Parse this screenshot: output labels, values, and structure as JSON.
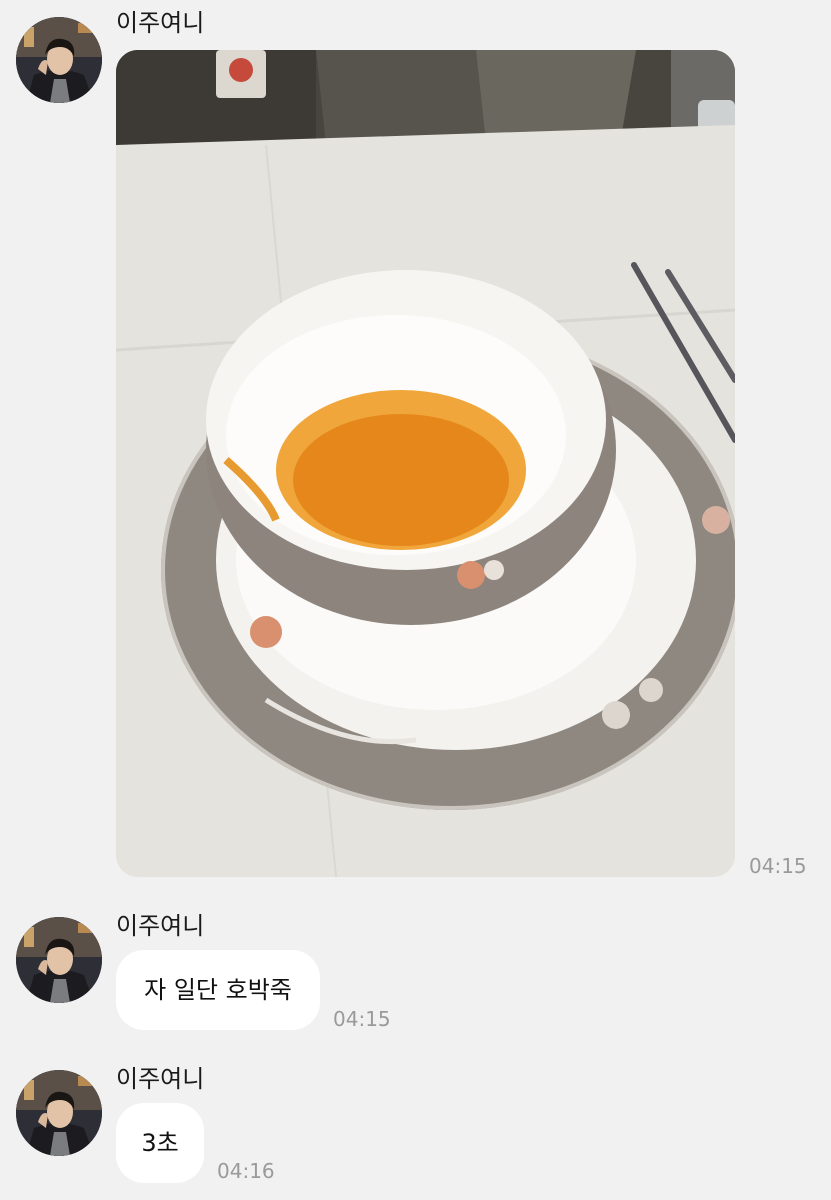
{
  "messages": [
    {
      "sender": "이주여니",
      "type": "photo",
      "photo_subject": "bowl-of-pumpkin-porridge",
      "time": "04:15"
    },
    {
      "sender": "이주여니",
      "type": "text",
      "text": "자 일단 호박죽",
      "time": "04:15"
    },
    {
      "sender": "이주여니",
      "type": "text",
      "text": "3초",
      "time": "04:16"
    }
  ],
  "colors": {
    "background": "#f1f1f1",
    "bubble": "#ffffff",
    "timestamp": "#9a9a9a"
  }
}
